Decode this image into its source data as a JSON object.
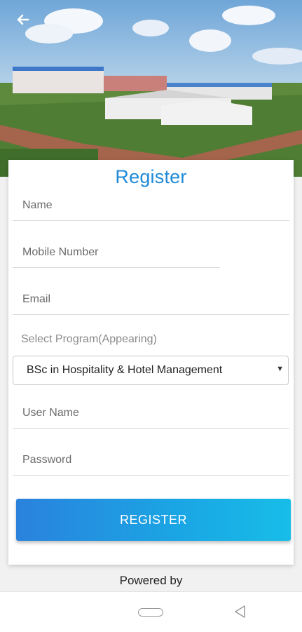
{
  "header": {
    "back_icon": "arrow-left-icon"
  },
  "form": {
    "title": "Register",
    "name_placeholder": "Name",
    "mobile_placeholder": "Mobile Number",
    "email_placeholder": "Email",
    "program_label": "Select Program(Appearing)",
    "program_selected": "BSc in Hospitality & Hotel Management",
    "username_placeholder": "User Name",
    "password_placeholder": "Password",
    "submit_label": "REGISTER"
  },
  "footer": {
    "powered_by": "Powered by"
  },
  "colors": {
    "accent": "#1e8ad6",
    "button_gradient_start": "#2a82dd",
    "button_gradient_end": "#17bde8"
  },
  "navbar": {
    "home_icon": "home-pill-icon",
    "back_icon": "back-triangle-icon"
  }
}
